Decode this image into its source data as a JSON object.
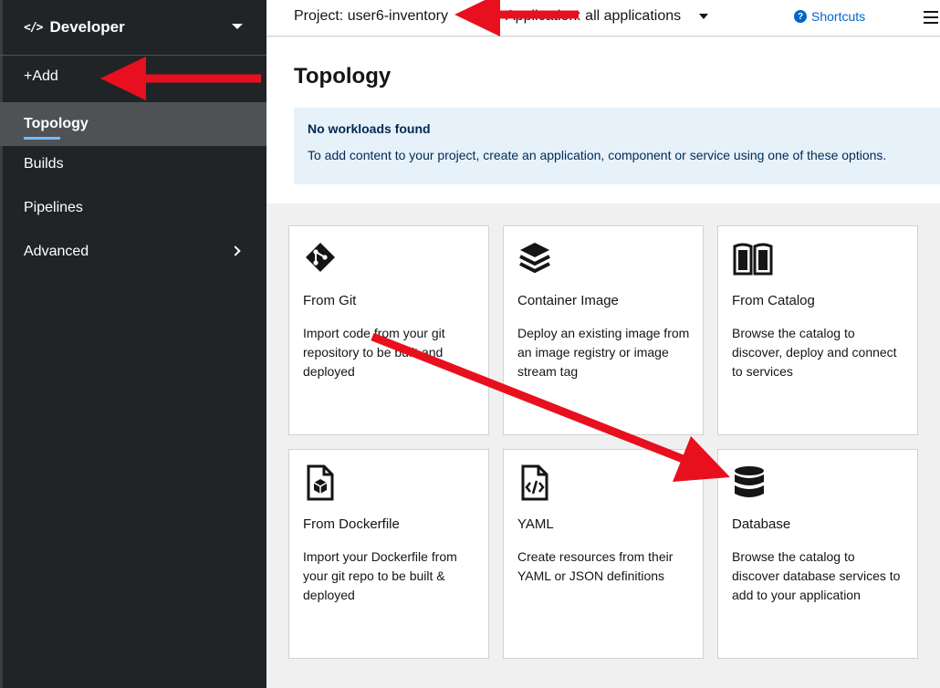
{
  "sidebar": {
    "perspective": {
      "icon": "code-icon",
      "icon_glyph": "</>",
      "label": "Developer"
    },
    "items": [
      {
        "label": "+Add"
      },
      {
        "label": "Topology",
        "active": true
      },
      {
        "label": "Builds"
      },
      {
        "label": "Pipelines"
      },
      {
        "label": "Advanced"
      }
    ]
  },
  "header": {
    "project": "Project: user6-inventory",
    "application": "Application: all applications",
    "shortcuts_icon_glyph": "?",
    "shortcuts": "Shortcuts"
  },
  "main": {
    "title": "Topology",
    "alert": {
      "title": "No workloads found",
      "body": "To add content to your project, create an application, component or service using one of these options."
    }
  },
  "cards": [
    {
      "icon": "git-icon",
      "title": "From Git",
      "desc": "Import code from your git repository to be built and deployed"
    },
    {
      "icon": "layers-icon",
      "title": "Container Image",
      "desc": "Deploy an existing image from an image registry or image stream tag"
    },
    {
      "icon": "book-icon",
      "title": "From Catalog",
      "desc": "Browse the catalog to discover, deploy and connect to services"
    },
    {
      "icon": "dockerfile-icon",
      "title": "From Dockerfile",
      "desc": "Import your Dockerfile from your git repo to be built & deployed"
    },
    {
      "icon": "yaml-icon",
      "title": "YAML",
      "desc": "Create resources from their YAML or JSON definitions"
    },
    {
      "icon": "database-icon",
      "title": "Database",
      "desc": "Browse the catalog to discover database services to add to your application"
    }
  ],
  "colors": {
    "sidebar_bg": "#212427",
    "active_bg": "#4f5255",
    "link": "#0066cc",
    "alert_bg": "#e7f1fa",
    "annotation_arrow": "#e8101e"
  }
}
